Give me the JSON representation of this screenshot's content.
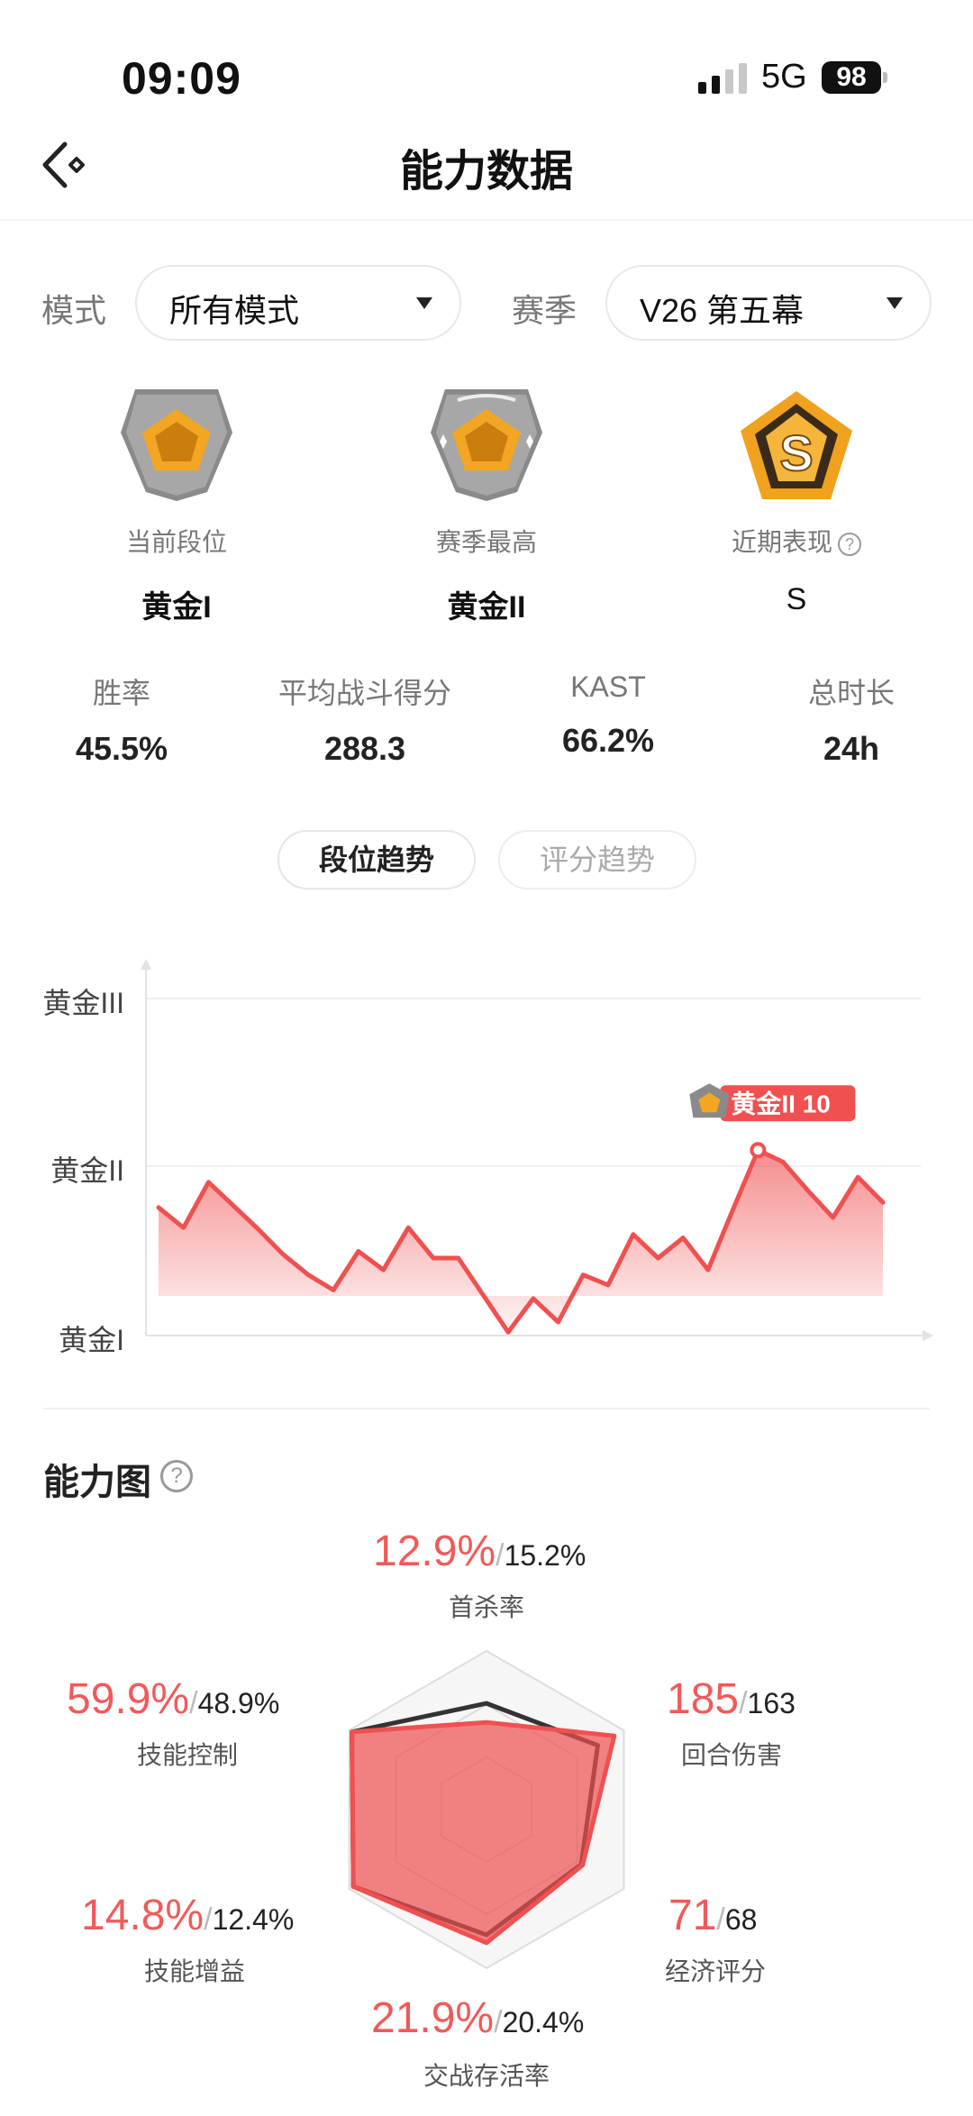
{
  "status_bar": {
    "time": "09:09",
    "network": "5G",
    "battery": "98"
  },
  "header": {
    "title": "能力数据"
  },
  "filters": {
    "mode_label": "模式",
    "mode_value": "所有模式",
    "season_label": "赛季",
    "season_value": "V26 第五幕"
  },
  "ranks": [
    {
      "label": "当前段位",
      "value": "黄金I"
    },
    {
      "label": "赛季最高",
      "value": "黄金II"
    },
    {
      "label": "近期表现",
      "value": "S",
      "help": "?"
    }
  ],
  "stats": [
    {
      "label": "胜率",
      "value": "45.5%"
    },
    {
      "label": "平均战斗得分",
      "value": "288.3"
    },
    {
      "label": "KAST",
      "value": "66.2%"
    },
    {
      "label": "总时长",
      "value": "24h"
    }
  ],
  "tabs": [
    {
      "label": "段位趋势",
      "active": true
    },
    {
      "label": "评分趋势",
      "active": false
    }
  ],
  "chart_data": {
    "type": "area",
    "y_tick_labels": [
      "黄金I",
      "黄金II",
      "黄金III"
    ],
    "ylim": [
      0,
      200
    ],
    "values": [
      76,
      64,
      91,
      77,
      63,
      48,
      36,
      27,
      50,
      39,
      64,
      46,
      46,
      24,
      2,
      22,
      8,
      36,
      30,
      60,
      46,
      58,
      39,
      75,
      110,
      103,
      86,
      70,
      94,
      79
    ],
    "highlight": {
      "index": 24,
      "label": "黄金II 10"
    },
    "color": "#f05050"
  },
  "ability": {
    "title": "能力图",
    "help": "?",
    "items": [
      {
        "label": "首杀率",
        "value": "12.9%",
        "avg": "15.2%"
      },
      {
        "label": "回合伤害",
        "value": "185",
        "avg": "163"
      },
      {
        "label": "经济评分",
        "value": "71",
        "avg": "68"
      },
      {
        "label": "交战存活率",
        "value": "21.9%",
        "avg": "20.4%"
      },
      {
        "label": "技能增益",
        "value": "14.8%",
        "avg": "12.4%"
      },
      {
        "label": "技能控制",
        "value": "59.9%",
        "avg": "48.9%"
      }
    ],
    "separator": "/",
    "player_levels": [
      0.55,
      0.93,
      0.7,
      0.84,
      0.97,
      0.98
    ],
    "average_levels": [
      0.67,
      0.81,
      0.69,
      0.79,
      0.97,
      0.98
    ],
    "player_color": "#f05050",
    "average_color": "#333333"
  }
}
